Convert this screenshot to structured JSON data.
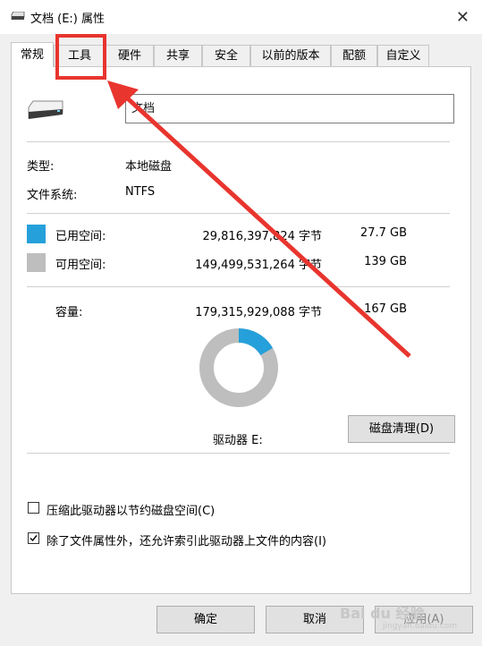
{
  "window": {
    "title": "文档 (E:) 属性",
    "close_glyph": "✕"
  },
  "tabs": [
    {
      "label": "常规"
    },
    {
      "label": "工具"
    },
    {
      "label": "硬件"
    },
    {
      "label": "共享"
    },
    {
      "label": "安全"
    },
    {
      "label": "以前的版本"
    },
    {
      "label": "配额"
    },
    {
      "label": "自定义"
    }
  ],
  "general": {
    "drive_name": "文档",
    "type_label": "类型:",
    "type_value": "本地磁盘",
    "fs_label": "文件系统:",
    "fs_value": "NTFS",
    "used": {
      "label": "已用空间:",
      "bytes": "29,816,397,824 字节",
      "size": "27.7 GB",
      "color": "#26a0da"
    },
    "free": {
      "label": "可用空间:",
      "bytes": "149,499,531,264 字节",
      "size": "139 GB",
      "color": "#bebebe"
    },
    "capacity": {
      "label": "容量:",
      "bytes": "179,315,929,088 字节",
      "size": "167 GB"
    },
    "used_fraction": 0.166,
    "drive_label": "驱动器 E:",
    "cleanup_button": "磁盘清理(D)",
    "compress_checkbox": {
      "label": "压缩此驱动器以节约磁盘空间(C)",
      "checked": false
    },
    "index_checkbox": {
      "label": "除了文件属性外，还允许索引此驱动器上文件的内容(I)",
      "checked": true
    }
  },
  "buttons": {
    "ok": "确定",
    "cancel": "取消",
    "apply": "应用(A)"
  },
  "annotation": {
    "color": "#e8352e",
    "highlight_tab": "工具"
  },
  "watermark": {
    "text": "Bai du 经验",
    "sub": "jingyan.baidu.com"
  }
}
